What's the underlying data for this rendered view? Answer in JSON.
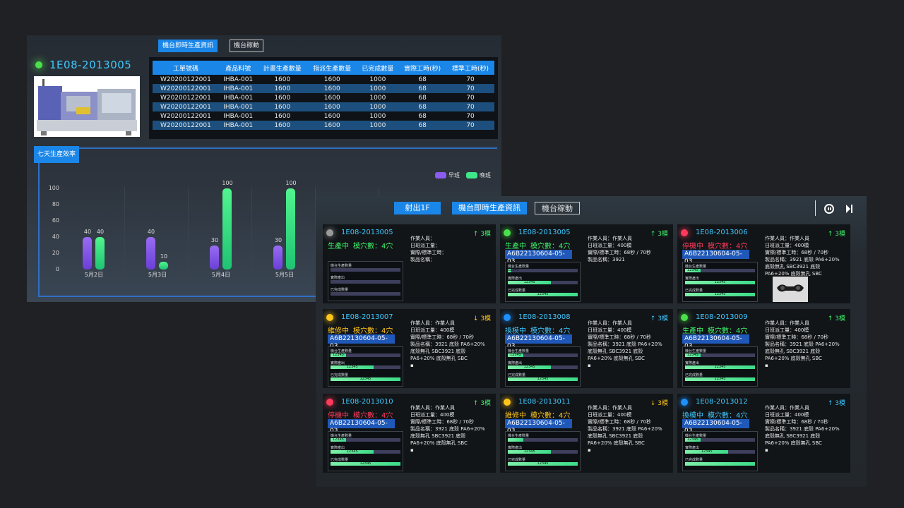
{
  "back": {
    "tab_active": "機台即時生產資訊",
    "tab_inactive": "機台稼動",
    "machine_name": "1E08-2013005",
    "status_color": "#4be04b",
    "table": {
      "headers": [
        "工單號碼",
        "產品料號",
        "計畫生產數量",
        "指派生產數量",
        "已完成數量",
        "實際工時(秒)",
        "標準工時(秒)"
      ],
      "rows": [
        [
          "W20200122001",
          "IHBA-001",
          "1600",
          "1600",
          "1000",
          "68",
          "70"
        ],
        [
          "W20200122001",
          "IHBA-001",
          "1600",
          "1600",
          "1000",
          "68",
          "70"
        ],
        [
          "W20200122001",
          "IHBA-001",
          "1600",
          "1600",
          "1000",
          "68",
          "70"
        ],
        [
          "W20200122001",
          "IHBA-001",
          "1600",
          "1600",
          "1000",
          "68",
          "70"
        ],
        [
          "W20200122001",
          "IHBA-001",
          "1600",
          "1600",
          "1000",
          "68",
          "70"
        ],
        [
          "W20200122001",
          "IHBA-001",
          "1600",
          "1600",
          "1000",
          "68",
          "70"
        ]
      ]
    },
    "efficiency_label": "七天生產效率",
    "chart_data": {
      "type": "bar",
      "categories": [
        "5月2日",
        "5月3日",
        "5月4日",
        "5月5日"
      ],
      "series": [
        {
          "name": "早班",
          "values": [
            40,
            40,
            30,
            30
          ],
          "color": "#8a5cf0"
        },
        {
          "name": "晚班",
          "values": [
            40,
            10,
            100,
            100
          ],
          "color": "#3ee88a"
        }
      ],
      "ylim": [
        0,
        100
      ],
      "yticks": [
        0,
        20,
        40,
        60,
        80,
        100
      ],
      "legend": "top-right"
    }
  },
  "front": {
    "area_tab": "射出1F",
    "tab_active": "機台即時生產資訊",
    "tab_inactive": "機台稼動",
    "pause_icon": "pause-icon",
    "next_icon": "skip-next-icon",
    "cards": [
      {
        "name": "1E08-2013005",
        "dot": "#9a9a9a",
        "status": "生產中",
        "status_color": "#3ef26a",
        "cavity": "模穴數：4穴",
        "trend": "↑ 3模",
        "trend_color": "#3ef26a",
        "info": [
          "作業人員：",
          "日班派工量：",
          "實際/標準工時：",
          "製品名稱："
        ],
        "progress": [
          {
            "label": "機台生產數量",
            "fill": 0,
            "value": ""
          },
          {
            "label": "實際產出",
            "fill": 0,
            "value": ""
          },
          {
            "label": "已完成數量",
            "fill": 0,
            "value": ""
          }
        ]
      },
      {
        "name": "1E08-2013005",
        "dot": "#4be04b",
        "status": "生產中",
        "status_color": "#3ef26a",
        "cavity": "模穴數：4穴",
        "trend": "↑ 3模",
        "trend_color": "#3ef26a",
        "code": "A6B22130604-05-03",
        "info": [
          "作業人員：作業人員",
          "日班派工量：400模",
          "實際/標準工時：68秒 / 70秒",
          "製品名稱：3921"
        ],
        "progress": [
          {
            "label": "機台生產數量",
            "fill": 0.05,
            "value": "12345"
          },
          {
            "label": "實際產出",
            "fill": 0.62,
            "value": "12345"
          },
          {
            "label": "已完成數量",
            "fill": 1,
            "value": "12345"
          }
        ]
      },
      {
        "name": "1E08-2013006",
        "dot": "#ff3b5c",
        "status": "停機中",
        "status_color": "#ff3b5c",
        "cavity": "模穴數：4穴",
        "trend": "↑ 3模",
        "trend_color": "#3ef26a",
        "code": "A6B22130604-05-03",
        "info": [
          "作業人員：作業人員",
          "日班派工量：400模",
          "實際/標準工時：68秒 / 70秒",
          "製品名稱：3921 底殼 PA6+20%",
          "底殼無孔 SBC3921 底殼",
          "PA6+20% 底殼無孔 SBC"
        ],
        "progress": [
          {
            "label": "機台生產數量",
            "fill": 0.22,
            "value": "12345"
          },
          {
            "label": "實際產出",
            "fill": 1,
            "value": "12345"
          },
          {
            "label": "已完成數量",
            "fill": 1,
            "value": "12345"
          }
        ],
        "has_image": true
      },
      {
        "name": "1E08-2013007",
        "dot": "#ffc61a",
        "status": "維修中",
        "status_color": "#ffc61a",
        "cavity": "模穴數：4穴",
        "trend": "↓ 3模",
        "trend_color": "#ffc61a",
        "code": "A6B22130604-05-03",
        "info": [
          "作業人員：作業人員",
          "日班派工量：400模",
          "實際/標準工時：68秒 / 70秒",
          "製品名稱：3921 底殼 PA6+20%",
          "底殼無孔 SBC3921 底殼",
          "PA6+20% 底殼無孔 SBC",
          "▪"
        ],
        "progress": [
          {
            "label": "機台生產數量",
            "fill": 0.22,
            "value": "12345"
          },
          {
            "label": "實際產出",
            "fill": 0.62,
            "value": "12345"
          },
          {
            "label": "已完成數量",
            "fill": 1,
            "value": "12345"
          }
        ]
      },
      {
        "name": "1E08-2013008",
        "dot": "#1e90ff",
        "status": "換模中",
        "status_color": "#3ec9ff",
        "cavity": "模穴數：4穴",
        "trend": "↑ 3模",
        "trend_color": "#3ec9ff",
        "code": "A6B22130604-05-03",
        "info": [
          "作業人員：作業人員",
          "日班派工量：400模",
          "實際/標準工時：68秒 / 70秒",
          "製品名稱：3921 底殼 PA6+20%",
          "底殼無孔 SBC3921 底殼",
          "PA6+20% 底殼無孔 SBC",
          "▪"
        ],
        "progress": [
          {
            "label": "機台生產數量",
            "fill": 0.22,
            "value": "12345"
          },
          {
            "label": "實際產出",
            "fill": 0.62,
            "value": "12345"
          },
          {
            "label": "已完成數量",
            "fill": 1,
            "value": "12345"
          }
        ]
      },
      {
        "name": "1E08-2013009",
        "dot": "#4be04b",
        "status": "生產中",
        "status_color": "#3ef26a",
        "cavity": "模穴數：4穴",
        "trend": "↑ 3模",
        "trend_color": "#3ef26a",
        "code": "A6B22130604-05-03",
        "info": [
          "作業人員：作業人員",
          "日班派工量：400模",
          "實際/標準工時：68秒 / 70秒",
          "製品名稱：3921 底殼 PA6+20%",
          "底殼無孔 SBC3921 底殼",
          "PA6+20% 底殼無孔 SBC",
          "▪"
        ],
        "progress": [
          {
            "label": "機台生產數量",
            "fill": 0.22,
            "value": "12345"
          },
          {
            "label": "實際產出",
            "fill": 1,
            "value": "12345"
          },
          {
            "label": "已完成數量",
            "fill": 1,
            "value": "12345"
          }
        ]
      },
      {
        "name": "1E08-2013010",
        "dot": "#ff3b5c",
        "status": "停機中",
        "status_color": "#ff3b5c",
        "cavity": "模穴數：4穴",
        "trend": "↑ 3模",
        "trend_color": "#3ef26a",
        "code": "A6B22130604-05-03",
        "info": [
          "作業人員：作業人員",
          "日班派工量：400模",
          "實際/標準工時：68秒 / 70秒",
          "製品名稱：3921 底殼 PA6+20%",
          "底殼無孔 SBC3921 底殼",
          "PA6+20% 底殼無孔 SBC",
          "▪"
        ],
        "progress": [
          {
            "label": "機台生產數量",
            "fill": 0.22,
            "value": "12345"
          },
          {
            "label": "實際產出",
            "fill": 0.62,
            "value": "12345"
          },
          {
            "label": "已完成數量",
            "fill": 1,
            "value": "12345"
          }
        ]
      },
      {
        "name": "1E08-2013011",
        "dot": "#ffc61a",
        "status": "維修中",
        "status_color": "#ffc61a",
        "cavity": "模穴數：4穴",
        "trend": "↓ 3模",
        "trend_color": "#ffc61a",
        "code": "A6B22130604-05-03",
        "info": [
          "作業人員：作業人員",
          "日班派工量：400模",
          "實際/標準工時：68秒 / 70秒",
          "製品名稱：3921 底殼 PA6+20%",
          "底殼無孔 SBC3921 底殼",
          "PA6+20% 底殼無孔 SBC",
          "▪"
        ],
        "progress": [
          {
            "label": "機台生產數量",
            "fill": 0.22,
            "value": ""
          },
          {
            "label": "實際產出",
            "fill": 0.62,
            "value": "12345"
          },
          {
            "label": "已完成數量",
            "fill": 1,
            "value": "12345"
          }
        ]
      },
      {
        "name": "1E08-2013012",
        "dot": "#1e90ff",
        "status": "換模中",
        "status_color": "#3ec9ff",
        "cavity": "模穴數：4穴",
        "trend": "↑ 3模",
        "trend_color": "#3ec9ff",
        "code": "A6B22130604-05-03",
        "info": [
          "作業人員：作業人員",
          "日班派工量：400模",
          "實際/標準工時：68秒 / 70秒",
          "製品名稱：3921 底殼 PA6+20%",
          "底殼無孔 SBC3921 底殼",
          "PA6+20% 底殼無孔 SBC",
          "▪"
        ],
        "progress": [
          {
            "label": "機台生產數量",
            "fill": 0.22,
            "value": "12345"
          },
          {
            "label": "實際產出",
            "fill": 0.62,
            "value": "12345"
          },
          {
            "label": "已完成數量",
            "fill": 1,
            "value": ""
          }
        ]
      }
    ]
  }
}
